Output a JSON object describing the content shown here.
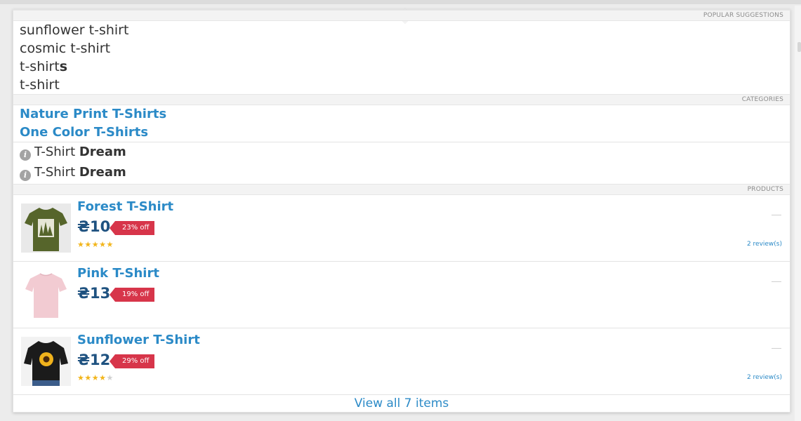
{
  "sections": {
    "popular": "POPULAR SUGGESTIONS",
    "categories": "CATEGORIES",
    "products": "PRODUCTS"
  },
  "suggestions": [
    {
      "text": "sunflower t-shirt"
    },
    {
      "text": "cosmic t-shirt"
    },
    {
      "prefix": "t-shirt",
      "bold": "s"
    },
    {
      "text": "t-shirt"
    }
  ],
  "categories": [
    "Nature Print T-Shirts",
    "One Color T-Shirts"
  ],
  "pages": [
    {
      "prefix": "T-Shirt ",
      "bold": "Dream",
      "icon": "info-icon"
    },
    {
      "prefix": "T-Shirt ",
      "bold": "Dream",
      "icon": "info-icon"
    }
  ],
  "products": [
    {
      "title": "Forest T-Shirt",
      "price": "₴10",
      "discount": "23% off",
      "rating": 4.5,
      "reviews": "2 review(s)",
      "image_color": "#56652b"
    },
    {
      "title": "Pink T-Shirt",
      "price": "₴13",
      "discount": "19% off",
      "rating": null,
      "reviews": "",
      "image_color": "#f2cbd2"
    },
    {
      "title": "Sunflower T-Shirt",
      "price": "₴12",
      "discount": "29% off",
      "rating": 4,
      "reviews": "2 review(s)",
      "image_color": "#1b1b1b"
    }
  ],
  "view_all": "View all 7 items",
  "colors": {
    "link": "#2b8ac7",
    "price": "#1f5280",
    "badge": "#d7354a",
    "star": "#f2b51b"
  }
}
